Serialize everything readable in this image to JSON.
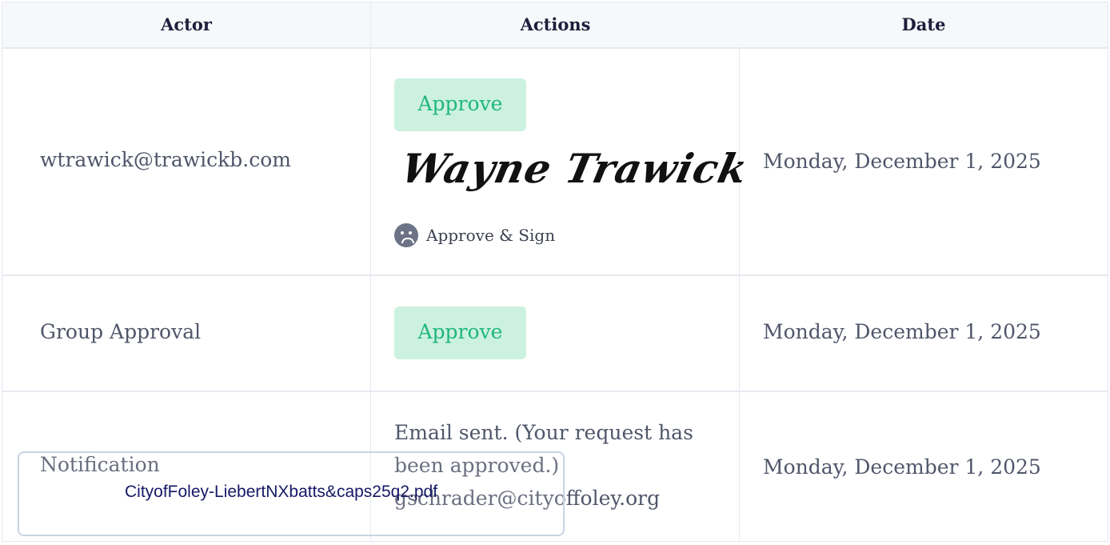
{
  "table": {
    "headers": {
      "actor": "Actor",
      "actions": "Actions",
      "date": "Date"
    },
    "rows": [
      {
        "actor": "wtrawick@trawickb.com",
        "approve_label": "Approve",
        "signature": "Wayne Trawick",
        "sign_label": "Approve & Sign",
        "date": "Monday, December 1, 2025"
      },
      {
        "actor": "Group Approval",
        "approve_label": "Approve",
        "date": "Monday, December 1, 2025"
      },
      {
        "actor": "Notification",
        "message_line1": "Email sent. (Your request has",
        "message_line2": "been approved.)",
        "message_line3": "gschrader@cityoffoley.org",
        "date": "Monday, December 1, 2025"
      }
    ]
  },
  "file_overlay": {
    "filename": "CityofFoley-LiebertNXbatts&caps25q2.pdf"
  },
  "colors": {
    "approve_bg": "#cdf1e0",
    "approve_text": "#1eb77a",
    "header_bg": "#f7f8fb",
    "border": "#e6e9ef",
    "filename_text": "#141866"
  }
}
